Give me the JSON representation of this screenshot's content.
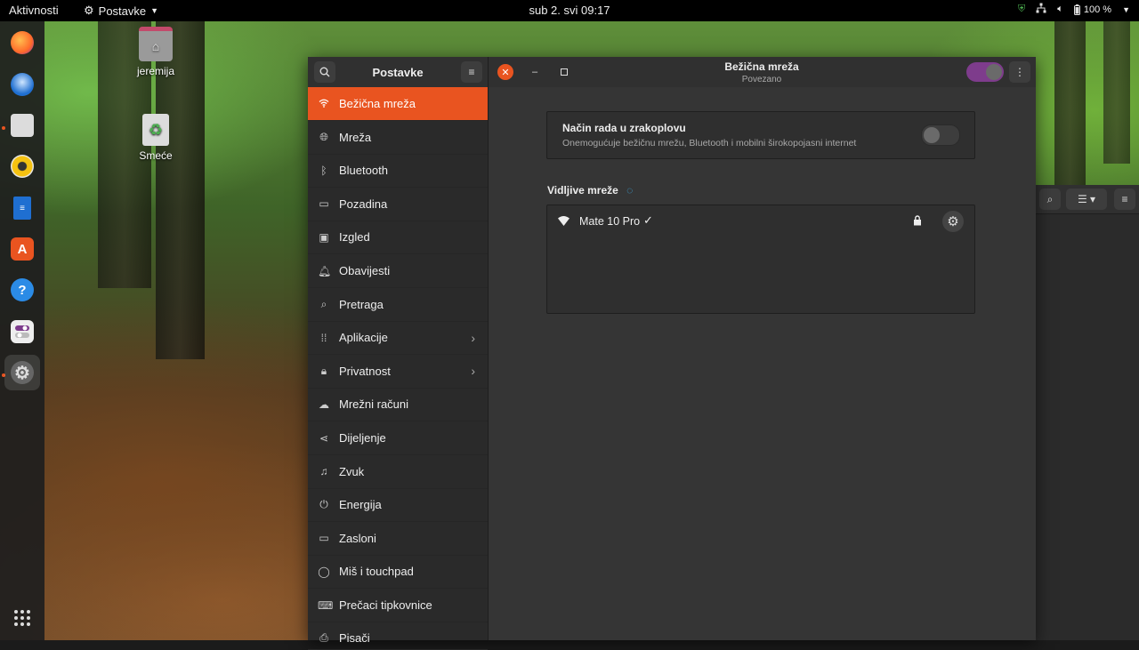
{
  "topbar": {
    "activities": "Aktivnosti",
    "app_menu": "Postavke",
    "clock": "sub 2. svi  09:17",
    "battery": "100 %"
  },
  "desktop": {
    "home_label": "jeremija",
    "trash_label": "Smeće"
  },
  "dock": {
    "apps": [
      "firefox",
      "thunderbird",
      "files",
      "rhythmbox",
      "libreoffice-writer",
      "ubuntu-software",
      "help",
      "tweaks",
      "settings"
    ]
  },
  "settings": {
    "sidebar_title": "Postavke",
    "page_title": "Bežična mreža",
    "page_subtitle": "Povezano",
    "wifi_enabled": true,
    "accent_color": "#e95420",
    "items": [
      {
        "label": "Bežična mreža",
        "icon": "wifi-icon"
      },
      {
        "label": "Mreža",
        "icon": "network-icon"
      },
      {
        "label": "Bluetooth",
        "icon": "bluetooth-icon"
      },
      {
        "label": "Pozadina",
        "icon": "background-icon"
      },
      {
        "label": "Izgled",
        "icon": "appearance-icon"
      },
      {
        "label": "Obavijesti",
        "icon": "bell-icon"
      },
      {
        "label": "Pretraga",
        "icon": "search-icon"
      },
      {
        "label": "Aplikacije",
        "icon": "apps-grid-icon"
      },
      {
        "label": "Privatnost",
        "icon": "lock-icon"
      },
      {
        "label": "Mrežni računi",
        "icon": "cloud-icon"
      },
      {
        "label": "Dijeljenje",
        "icon": "share-icon"
      },
      {
        "label": "Zvuk",
        "icon": "music-note-icon"
      },
      {
        "label": "Energija",
        "icon": "power-icon"
      },
      {
        "label": "Zasloni",
        "icon": "display-icon"
      },
      {
        "label": "Miš i touchpad",
        "icon": "mouse-icon"
      },
      {
        "label": "Prečaci tipkovnice",
        "icon": "keyboard-icon"
      },
      {
        "label": "Pisači",
        "icon": "printer-icon"
      }
    ],
    "airplane": {
      "title": "Način rada u zrakoplovu",
      "description": "Onemogućuje bežičnu mrežu, Bluetooth i mobilni širokopojasni internet",
      "enabled": false
    },
    "visible_networks_title": "Vidljive mreže",
    "networks": [
      {
        "name": "Mate 10 Pro",
        "connected": true,
        "secured": true
      }
    ]
  }
}
